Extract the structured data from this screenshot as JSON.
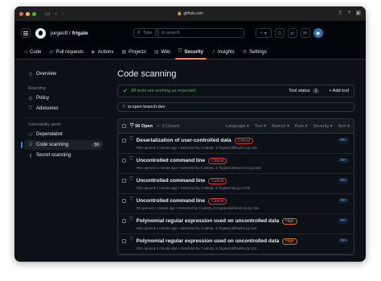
{
  "browser": {
    "url": "github.com",
    "dots": [
      "#ff5f57",
      "#febc2e",
      "#28c840"
    ]
  },
  "header": {
    "owner": "jorgectf",
    "separator": "/",
    "repo": "frigate",
    "search_placeholder": "Type / to search",
    "search_prefix": "Type",
    "search_slash": "/",
    "search_suffix": "to search",
    "plus": "+ ▾"
  },
  "repo_nav": [
    {
      "label": "Code",
      "icon": "code-icon",
      "glyph": "‹›"
    },
    {
      "label": "Pull requests",
      "icon": "pull-request-icon",
      "glyph": "⇄"
    },
    {
      "label": "Actions",
      "icon": "actions-icon",
      "glyph": "▶"
    },
    {
      "label": "Projects",
      "icon": "projects-icon",
      "glyph": "▦"
    },
    {
      "label": "Wiki",
      "icon": "wiki-icon",
      "glyph": "▤"
    },
    {
      "label": "Security",
      "icon": "shield-icon",
      "glyph": "⛉",
      "active": true
    },
    {
      "label": "Insights",
      "icon": "insights-icon",
      "glyph": "↗"
    },
    {
      "label": "Settings",
      "icon": "gear-icon",
      "glyph": "⚙"
    }
  ],
  "sidebar": {
    "overview": "Overview",
    "reporting_heading": "Reporting",
    "policy": "Policy",
    "advisories": "Advisories",
    "vuln_heading": "Vulnerability alerts",
    "dependabot": "Dependabot",
    "code_scanning": "Code scanning",
    "code_scanning_count": "56",
    "secret_scanning": "Secret scanning"
  },
  "main": {
    "title": "Code scanning",
    "banner_text": "All tools are working as expected",
    "tool_status": "Tool status",
    "tool_count": "1",
    "add_tool": "+ Add tool",
    "filter_value": "is:open branch:dev",
    "open_count": "56 Open",
    "closed_count": "0 Closed",
    "filters": [
      "Language ▾",
      "Tool ▾",
      "Branch ▾",
      "Rule ▾",
      "Severity ▾",
      "Sort ▾"
    ]
  },
  "alerts": [
    {
      "title": "Deserialization of user-controlled data",
      "severity": "Critical",
      "sev_class": "critical",
      "meta": "#58 opened 1 minute ago • Detected by CodeQL in frigate/util/builtin.py:150",
      "branch": "dev"
    },
    {
      "title": "Uncontrolled command line",
      "severity": "Critical",
      "sev_class": "critical",
      "meta": "#53 opened 1 minute ago • Detected by CodeQL in frigate/util/services.py:343",
      "branch": "dev"
    },
    {
      "title": "Uncontrolled command line",
      "severity": "Critical",
      "sev_class": "critical",
      "meta": "#52 opened 1 minute ago • Detected by CodeQL in frigate/http.py:1478",
      "branch": "dev"
    },
    {
      "title": "Uncontrolled command line",
      "severity": "Critical",
      "sev_class": "critical",
      "meta": "#3 opened 1 minute ago • Detected by CodeQL in frigate/util/services.py:166",
      "branch": "dev"
    },
    {
      "title": "Polynomial regular expression used on uncontrolled data",
      "severity": "High",
      "sev_class": "high",
      "meta": "#55 opened 1 minute ago • Detected by CodeQL in frigate/util/builtin.py:110",
      "branch": "dev"
    },
    {
      "title": "Polynomial regular expression used on uncontrolled data",
      "severity": "High",
      "sev_class": "high",
      "meta": "#54 opened 1 minute ago • Detected by CodeQL in frigate/util/builtin.py:110",
      "branch": "dev"
    }
  ]
}
